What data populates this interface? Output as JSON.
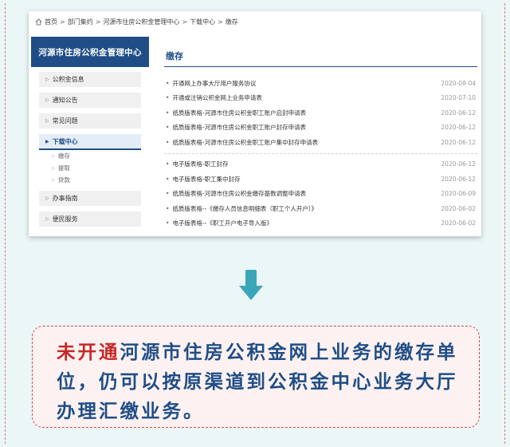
{
  "breadcrumb": [
    "首页",
    "部门集约",
    "河源市住房公积金管理中心",
    "下载中心",
    "缴存"
  ],
  "breadcrumb_separator": ">",
  "sidebar": {
    "title": "河源市住房公积金管理中心",
    "items": [
      {
        "label": "公积金信息"
      },
      {
        "label": "通知公告"
      },
      {
        "label": "常见问题"
      },
      {
        "label": "下载中心",
        "active": true,
        "subitems": [
          "缴存",
          "提取",
          "贷款"
        ]
      },
      {
        "label": "办事指南"
      },
      {
        "label": "便民服务"
      }
    ]
  },
  "content": {
    "title": "缴存",
    "group1": [
      {
        "title": "开通网上办事大厅用户服务协议",
        "date": "2020-08-04"
      },
      {
        "title": "开通或注销公积金网上业务申请表",
        "date": "2020-07-10"
      },
      {
        "title": "纸质版表格-河源市住房公积金职工账户启封申请表",
        "date": "2020-06-12"
      },
      {
        "title": "纸质版表格-河源市住房公积金职工账户封存申请表",
        "date": "2020-06-12"
      },
      {
        "title": "纸质版表格-河源市住房公积金职工账户集中封存申请表",
        "date": "2020-06-12"
      }
    ],
    "group2": [
      {
        "title": "电子版表格-职工封存",
        "date": "2020-06-12"
      },
      {
        "title": "电子版表格-职工集中封存",
        "date": "2020-06-12"
      },
      {
        "title": "纸质版表格-河源市住房公积金缴存基数调整申请表",
        "date": "2020-06-09"
      },
      {
        "title": "纸质版表格--《缴存人员信息明细表（职工个人开户）》",
        "date": "2020-06-02"
      },
      {
        "title": "电子版表格--《职工开户电子导入版》",
        "date": "2020-06-02"
      }
    ]
  },
  "note": {
    "emphasis": "未开通",
    "text": "河源市住房公积金网上业务的缴存单位，仍可以按原渠道到公积金中心业务大厅办理汇缴业务。"
  },
  "colors": {
    "brand": "#1f4e87",
    "accent_red": "#c62828",
    "arrow": "#3aa6b9",
    "background": "#eaf7f6"
  }
}
